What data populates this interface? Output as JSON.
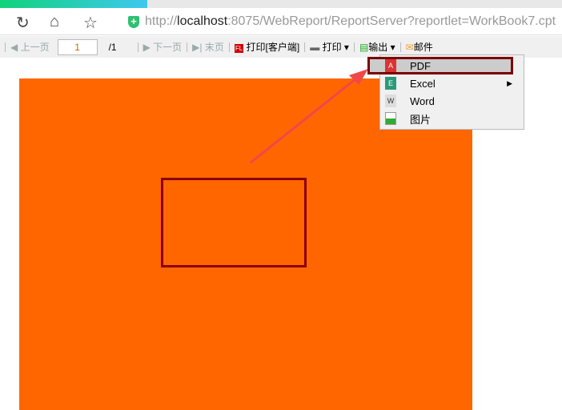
{
  "browser": {
    "url_prefix": "http://",
    "url_host": "localhost",
    "url_rest": ":8075/WebReport/ReportServer?reportlet=WorkBook7.cpt"
  },
  "toolbar": {
    "prev": "上一页",
    "page": "1",
    "total": "/1",
    "next": "下一页",
    "last": "末页",
    "print_client": "打印[客户端]",
    "print": "打印",
    "export": "输出",
    "email": "邮件"
  },
  "menu": {
    "items": [
      {
        "label": "PDF"
      },
      {
        "label": "Excel"
      },
      {
        "label": "Word"
      },
      {
        "label": "图片"
      }
    ]
  }
}
